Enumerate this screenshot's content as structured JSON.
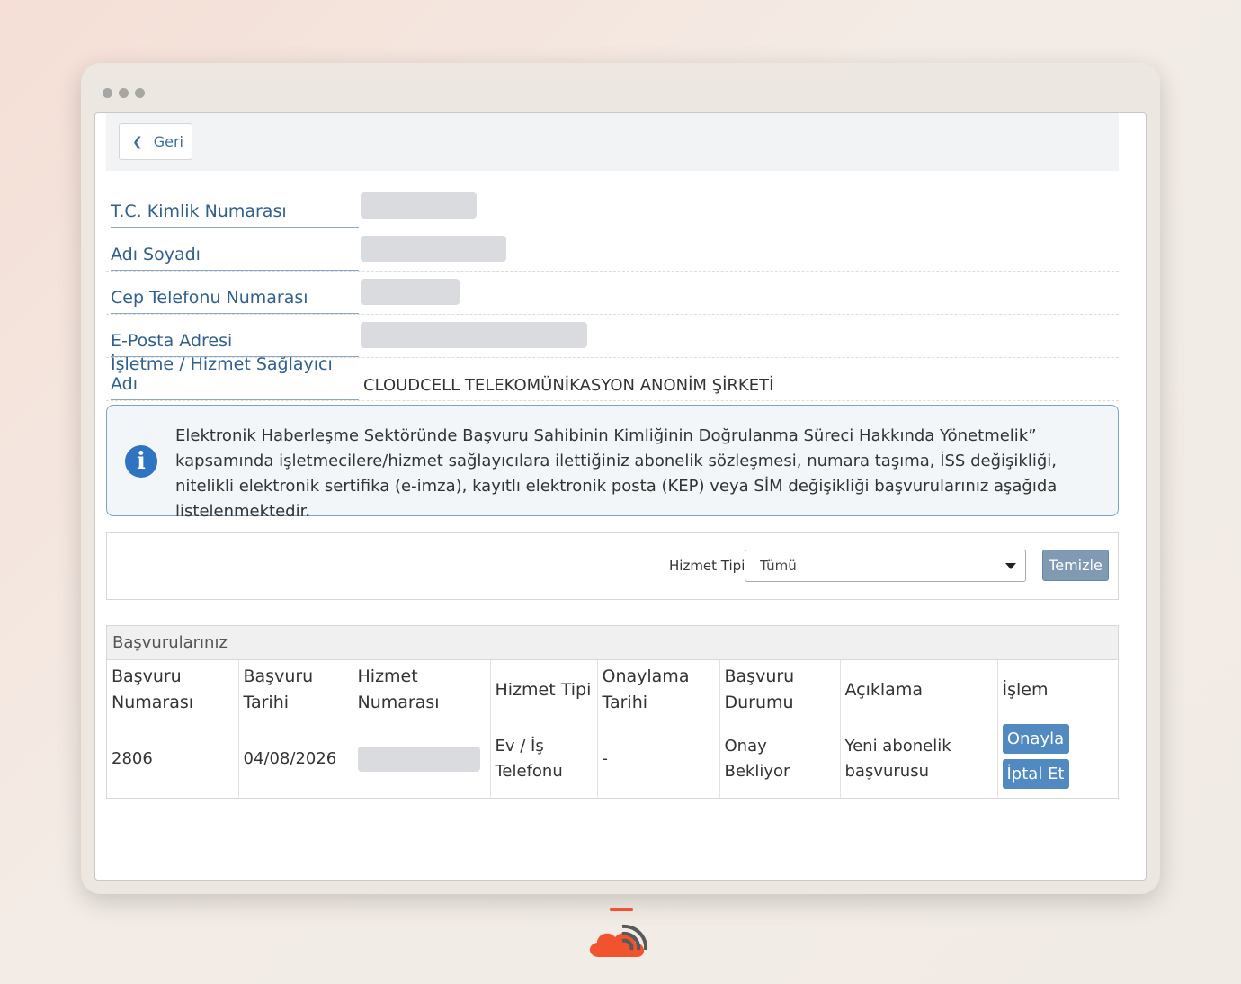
{
  "nav": {
    "back_label": "Geri"
  },
  "info": {
    "rows": [
      {
        "label": "T.C. Kimlik Numarası",
        "value": ""
      },
      {
        "label": "Adı Soyadı",
        "value": ""
      },
      {
        "label": "Cep Telefonu Numarası",
        "value": ""
      },
      {
        "label": "E-Posta Adresi",
        "value": ""
      },
      {
        "label": "İşletme / Hizmet Sağlayıcı Adı",
        "value": "CLOUDCELL TELEKOMÜNİKASYON ANONİM ŞİRKETİ"
      }
    ]
  },
  "alert": {
    "icon": "info-icon",
    "text": "Elektronik Haberleşme Sektöründe Başvuru Sahibinin Kimliğinin Doğrulanma Süreci Hakkında Yönetmelik” kapsamında işletmecilere/hizmet sağlayıcılara ilettiğiniz abonelik sözleşmesi, numara taşıma, İSS değişikliği, nitelikli elektronik sertifika (e-imza), kayıtlı elektronik posta (KEP) veya SİM değişikliği başvurularınız aşağıda listelenmektedir."
  },
  "filter": {
    "label": "Hizmet Tipi",
    "selected": "Tümü",
    "clear_label": "Temizle"
  },
  "applications": {
    "title": "Başvurularınız",
    "columns": [
      "Başvuru Numarası",
      "Başvuru Tarihi",
      "Hizmet Numarası",
      "Hizmet Tipi",
      "Onaylama Tarihi",
      "Başvuru Durumu",
      "Açıklama",
      "İşlem"
    ],
    "rows": [
      {
        "number": "2806",
        "date": "04/08/2026",
        "service_number": "",
        "service_type": "Ev / İş Telefonu",
        "approval_date": "-",
        "status": "Onay Bekliyor",
        "description": "Yeni abonelik başvurusu",
        "approve_label": "Onayla",
        "cancel_label": "İptal Et"
      }
    ]
  },
  "colors": {
    "accent": "#2f5f8f",
    "button": "#5189c1",
    "brand": "#f0532d"
  }
}
